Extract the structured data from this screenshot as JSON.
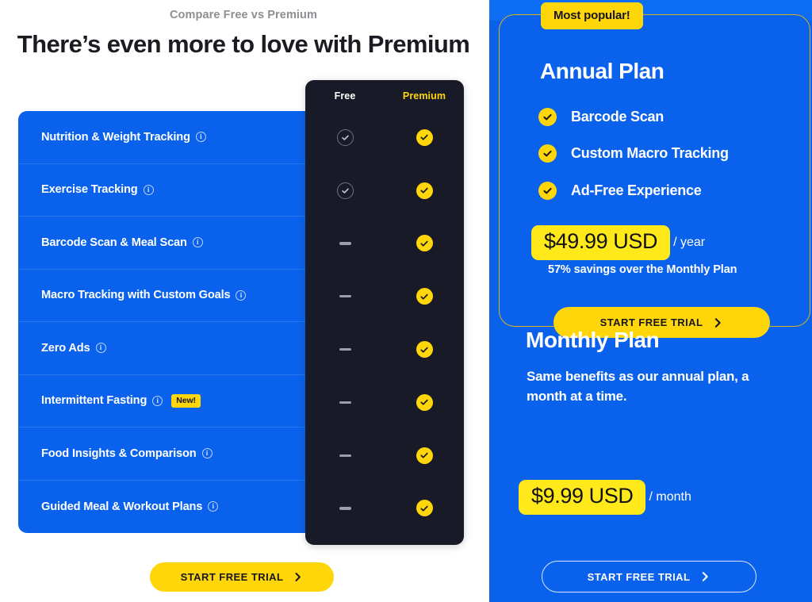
{
  "left": {
    "eyebrow": "Compare Free vs Premium",
    "headline": "There’s even more to love with Premium",
    "columns": {
      "free": "Free",
      "premium": "Premium"
    },
    "info_icon_glyph": "i",
    "features": [
      {
        "label": "Nutrition & Weight Tracking",
        "free": "check",
        "premium": "check",
        "badge": null
      },
      {
        "label": "Exercise Tracking",
        "free": "check",
        "premium": "check",
        "badge": null
      },
      {
        "label": "Barcode Scan & Meal Scan",
        "free": "dash",
        "premium": "check",
        "badge": null
      },
      {
        "label": "Macro Tracking with Custom Goals",
        "free": "dash",
        "premium": "check",
        "badge": null
      },
      {
        "label": "Zero Ads",
        "free": "dash",
        "premium": "check",
        "badge": null
      },
      {
        "label": "Intermittent Fasting",
        "free": "dash",
        "premium": "check",
        "badge": "New!"
      },
      {
        "label": "Food Insights & Comparison",
        "free": "dash",
        "premium": "check",
        "badge": null
      },
      {
        "label": "Guided Meal & Workout Plans",
        "free": "dash",
        "premium": "check",
        "badge": null
      }
    ],
    "cta_label": "START FREE TRIAL"
  },
  "right": {
    "popular_badge": "Most popular!",
    "annual": {
      "title": "Annual Plan",
      "benefits": [
        "Barcode Scan",
        "Custom Macro Tracking",
        "Ad-Free Experience"
      ],
      "price": "$49.99 USD",
      "period": "/ year",
      "savings": "57% savings over the Monthly Plan",
      "cta_label": "START FREE TRIAL"
    },
    "monthly": {
      "title": "Monthly Plan",
      "description": "Same benefits as our annual plan, a month at a time.",
      "price": "$9.99 USD",
      "period": "/ month",
      "cta_label": "START FREE TRIAL"
    }
  },
  "colors": {
    "brand_blue": "#0a62ec",
    "accent_yellow": "#ffd60a",
    "highlight_yellow": "#ffe91b",
    "dark_panel": "#181a28",
    "card_border": "#d9b21e"
  }
}
